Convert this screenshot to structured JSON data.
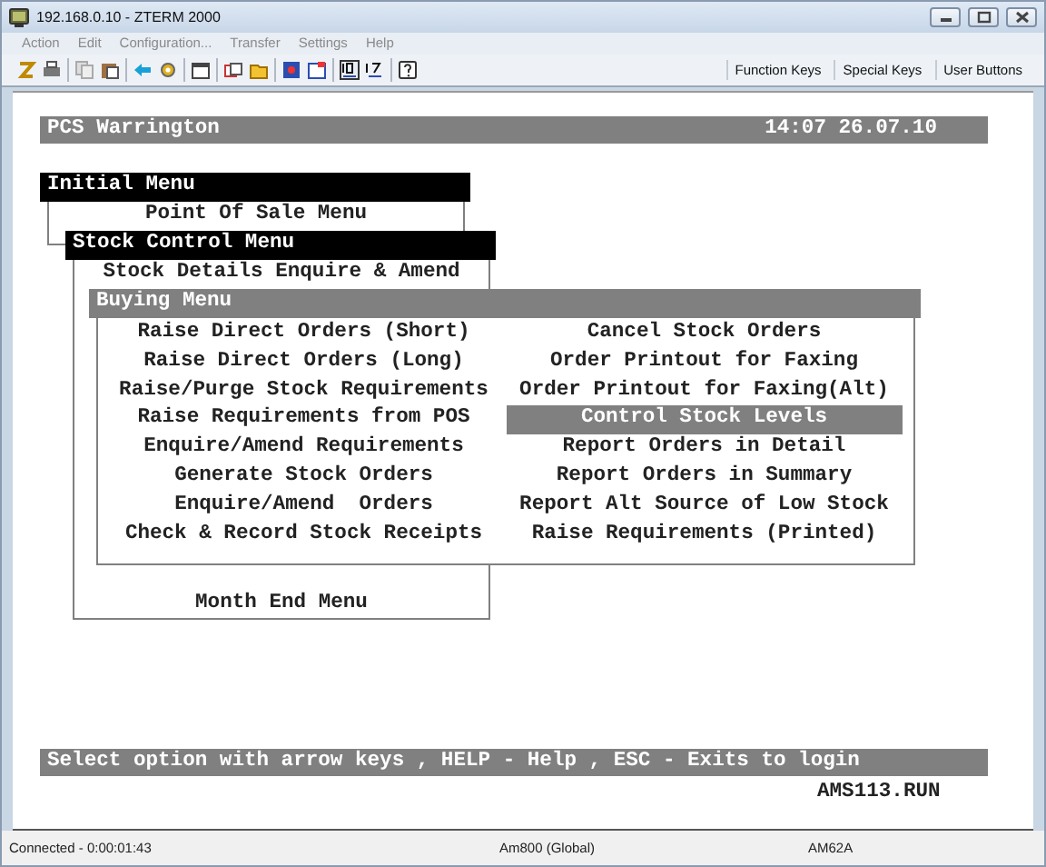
{
  "window": {
    "title": "192.168.0.10 - ZTERM 2000"
  },
  "menu_bar": [
    "Action",
    "Edit",
    "Configuration...",
    "Transfer",
    "Settings",
    "Help"
  ],
  "toolbar": {
    "buttons": [
      "Function Keys",
      "Special Keys",
      "User Buttons"
    ]
  },
  "terminal": {
    "header": {
      "title": "PCS Warrington",
      "datetime": "14:07 26.07.10"
    },
    "menus": [
      {
        "title": "Initial Menu",
        "kind": "parent",
        "items": [
          "Point Of Sale Menu"
        ]
      },
      {
        "title": "Stock Control Menu",
        "kind": "parent",
        "items": [
          "Stock Details Enquire & Amend",
          "Month End Menu"
        ]
      },
      {
        "title": "Buying Menu",
        "kind": "active",
        "items": [
          {
            "label": "Raise Direct Orders (Short)",
            "selected": false
          },
          {
            "label": "Cancel Stock Orders",
            "selected": false
          },
          {
            "label": "Raise Direct Orders (Long)",
            "selected": false
          },
          {
            "label": "Order Printout for Faxing",
            "selected": false
          },
          {
            "label": "Raise/Purge Stock Requirements",
            "selected": false
          },
          {
            "label": "Order Printout for Faxing(Alt)",
            "selected": false
          },
          {
            "label": "Raise Requirements from POS",
            "selected": false
          },
          {
            "label": "Control Stock Levels",
            "selected": true
          },
          {
            "label": "Enquire/Amend Requirements",
            "selected": false
          },
          {
            "label": "Report Orders in Detail",
            "selected": false
          },
          {
            "label": "Generate Stock Orders",
            "selected": false
          },
          {
            "label": "Report Orders in Summary",
            "selected": false
          },
          {
            "label": "Enquire/Amend  Orders",
            "selected": false
          },
          {
            "label": "Report Alt Source of Low Stock",
            "selected": false
          },
          {
            "label": "Check & Record Stock Receipts",
            "selected": false
          },
          {
            "label": "Raise Requirements (Printed)",
            "selected": false
          }
        ]
      }
    ],
    "prompt": "Select option with arrow keys , HELP - Help , ESC - Exits to login",
    "program": "AMS113.RUN"
  },
  "status_bar": [
    "Connected - 0:00:01:43",
    "Am800 (Global)",
    "AM62A"
  ]
}
